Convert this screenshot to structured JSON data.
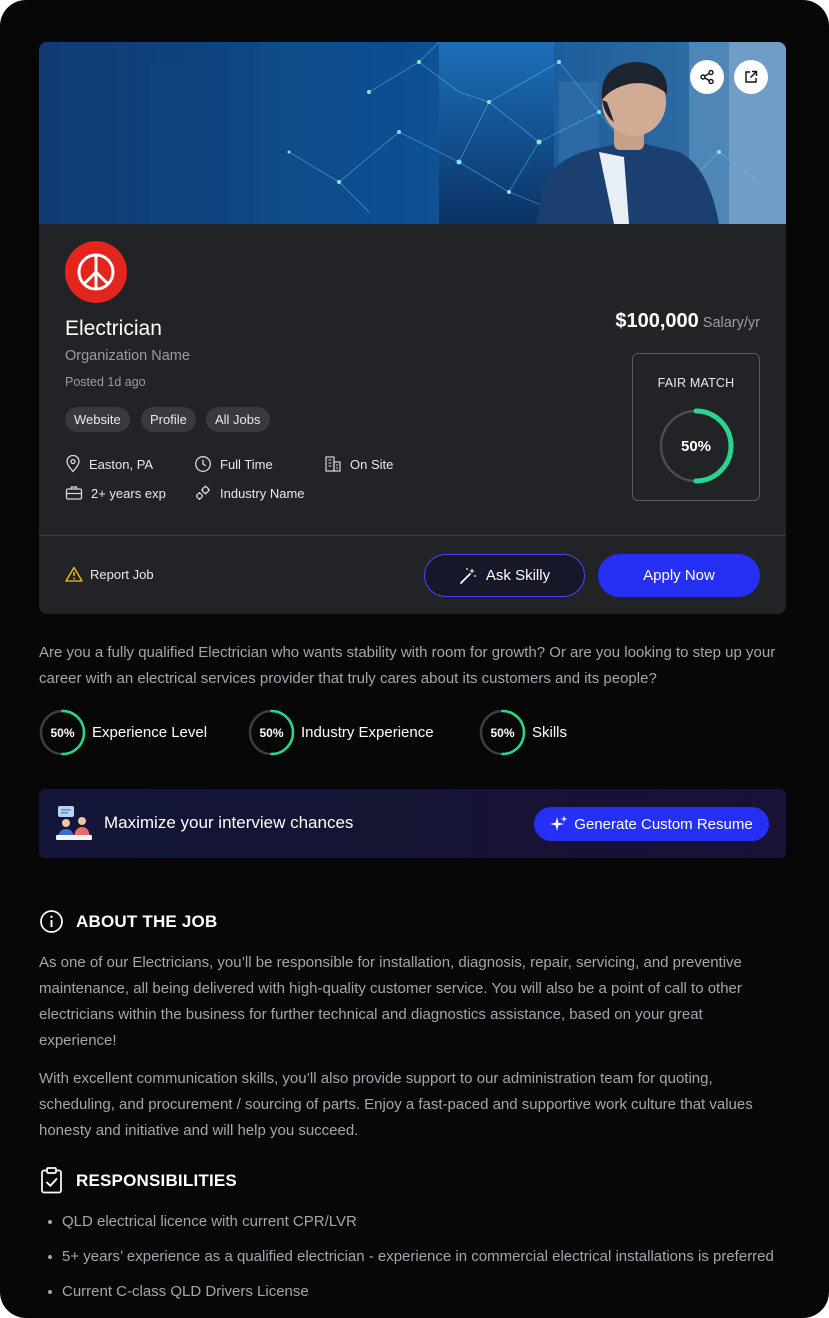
{
  "job": {
    "title": "Electrician",
    "organization": "Organization Name",
    "posted": "Posted 1d ago",
    "salary": "$100,000",
    "salary_unit": "Salary/yr",
    "links": [
      "Website",
      "Profile",
      "All Jobs"
    ],
    "location": "Easton, PA",
    "employment_type": "Full Time",
    "workplace": "On Site",
    "experience": "2+ years exp",
    "industry": "Industry Name"
  },
  "match": {
    "label": "FAIR MATCH",
    "percent_text": "50%",
    "percent": 50
  },
  "actions": {
    "report": "Report Job",
    "ask": "Ask Skilly",
    "apply": "Apply Now"
  },
  "intro": "Are you a fully qualified Electrician who wants stability with room for growth? Or are you looking to step up your career with an electrical services provider that truly cares about its customers and its people?",
  "scores": [
    {
      "label": "Experience Level",
      "percent_text": "50%",
      "percent": 50
    },
    {
      "label": "Industry Experience",
      "percent_text": "50%",
      "percent": 50
    },
    {
      "label": "Skills",
      "percent_text": "50%",
      "percent": 50
    }
  ],
  "promo": {
    "text": "Maximize your interview chances",
    "button": "Generate Custom Resume"
  },
  "about": {
    "heading": "ABOUT THE JOB",
    "paragraphs": [
      "As one of our Electricians, you’ll be responsible for installation, diagnosis, repair, servicing, and preventive maintenance, all being delivered with high-quality customer service. You will also be a point of call to other electricians within the business for further technical and diagnostics assistance, based on your great experience!",
      "With excellent communication skills, you’ll also provide support to our administration team for quoting, scheduling, and procurement / sourcing of parts. Enjoy a fast-paced and supportive work culture that values honesty and initiative and will help you succeed."
    ]
  },
  "responsibilities": {
    "heading": "RESPONSIBILITIES",
    "items": [
      "QLD electrical licence with current CPR/LVR",
      "5+ years’ experience as a qualified electrician - experience in commercial electrical installations is preferred",
      "Current C-class QLD Drivers License"
    ]
  },
  "colors": {
    "accent": "#2630f5",
    "ring": "#27d68a",
    "logo": "#e4251f"
  }
}
